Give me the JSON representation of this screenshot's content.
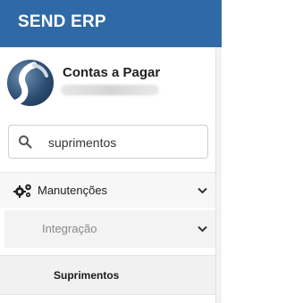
{
  "header": {
    "brand": "SEND ERP",
    "color": "#2f6aa6"
  },
  "profile": {
    "title": "Contas a Pagar",
    "avatar_icon": "company-logo-icon"
  },
  "search": {
    "value": "suprimentos",
    "icon": "search-icon"
  },
  "menu": {
    "manutencoes": {
      "label": "Manutenções",
      "icon": "gears-icon",
      "expanded": true
    },
    "integracao": {
      "label": "Integração",
      "expanded": true
    },
    "suprimentos": {
      "label": "Suprimentos",
      "active": true
    }
  }
}
